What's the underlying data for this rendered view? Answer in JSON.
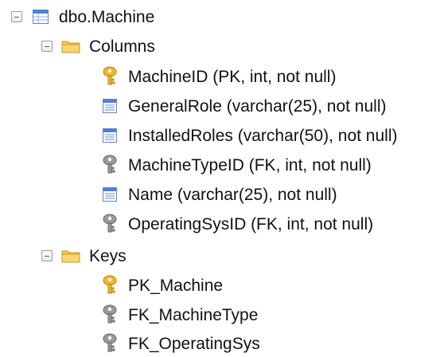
{
  "tree": {
    "table": {
      "label": "dbo.Machine",
      "icon": "table-icon"
    },
    "columns_folder": {
      "label": "Columns",
      "icon": "folder-icon"
    },
    "columns": [
      {
        "label": "MachineID (PK, int, not null)",
        "icon": "primary-key-icon"
      },
      {
        "label": "GeneralRole (varchar(25), not null)",
        "icon": "column-icon"
      },
      {
        "label": "InstalledRoles (varchar(50), not null)",
        "icon": "column-icon"
      },
      {
        "label": "MachineTypeID (FK, int, not null)",
        "icon": "foreign-key-icon"
      },
      {
        "label": "Name (varchar(25), not null)",
        "icon": "column-icon"
      },
      {
        "label": "OperatingSysID (FK, int, not null)",
        "icon": "foreign-key-icon"
      }
    ],
    "keys_folder": {
      "label": "Keys",
      "icon": "folder-icon"
    },
    "keys": [
      {
        "label": "PK_Machine",
        "icon": "primary-key-icon"
      },
      {
        "label": "FK_MachineType",
        "icon": "foreign-key-icon"
      },
      {
        "label": "FK_OperatingSys",
        "icon": "foreign-key-icon"
      }
    ]
  },
  "colors": {
    "primary_key": "#e8a81f",
    "foreign_key": "#8f8f8f",
    "folder": "#e8bf3b",
    "table_header": "#4f7fd6"
  }
}
